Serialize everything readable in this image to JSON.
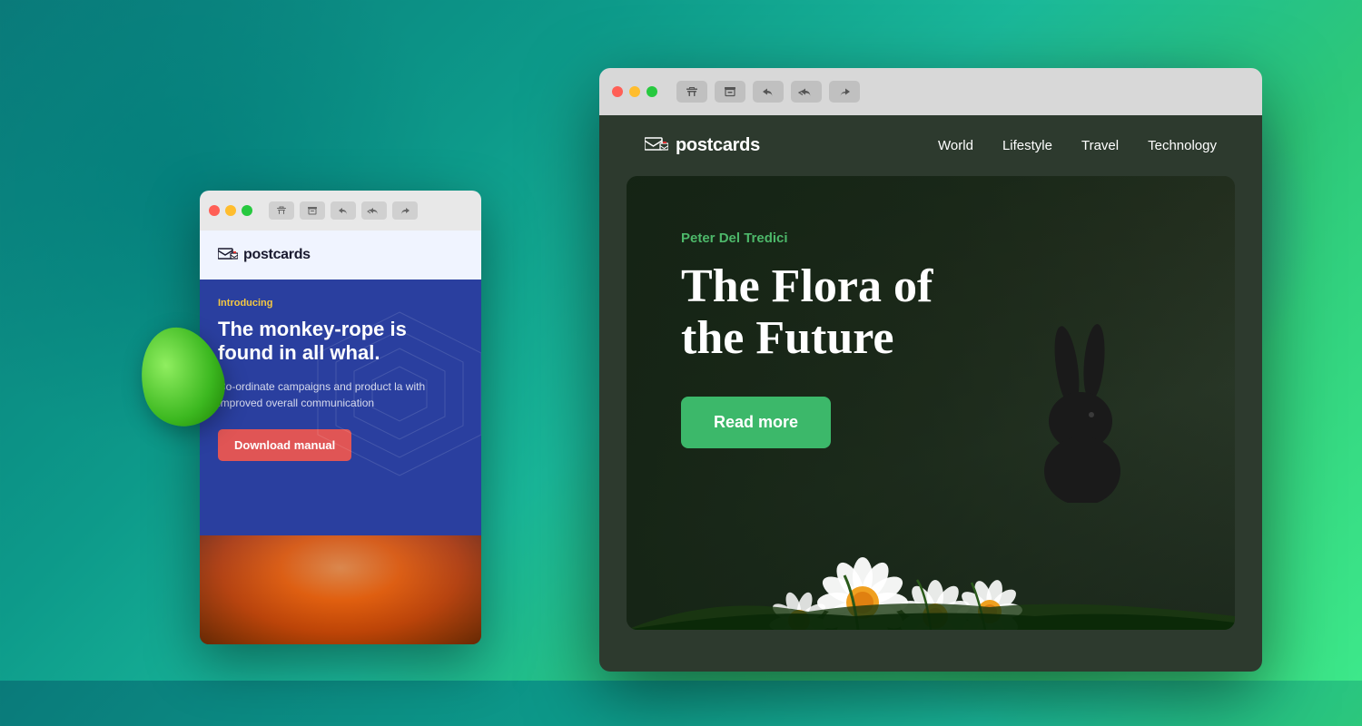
{
  "background": {
    "gradient_desc": "teal to green gradient background"
  },
  "window_back": {
    "logo_text": "postcards",
    "introducing_label": "Introducing",
    "headline": "The monkey-rope is found in all whal.",
    "body_text": "Co-ordinate campaigns and product la with improved overall communication",
    "download_button": "Download manual",
    "titlebar": {
      "buttons": [
        "delete",
        "archive",
        "reply",
        "reply-all",
        "forward"
      ]
    }
  },
  "window_front": {
    "logo_text": "postcards",
    "nav_links": [
      "World",
      "Lifestyle",
      "Travel",
      "Technology"
    ],
    "hero": {
      "author": "Peter Del Tredici",
      "title_line1": "The Flora of",
      "title_line2": "the Future",
      "read_more_button": "Read more"
    },
    "titlebar": {
      "buttons": [
        "delete",
        "archive",
        "reply",
        "reply-all",
        "forward"
      ]
    }
  }
}
